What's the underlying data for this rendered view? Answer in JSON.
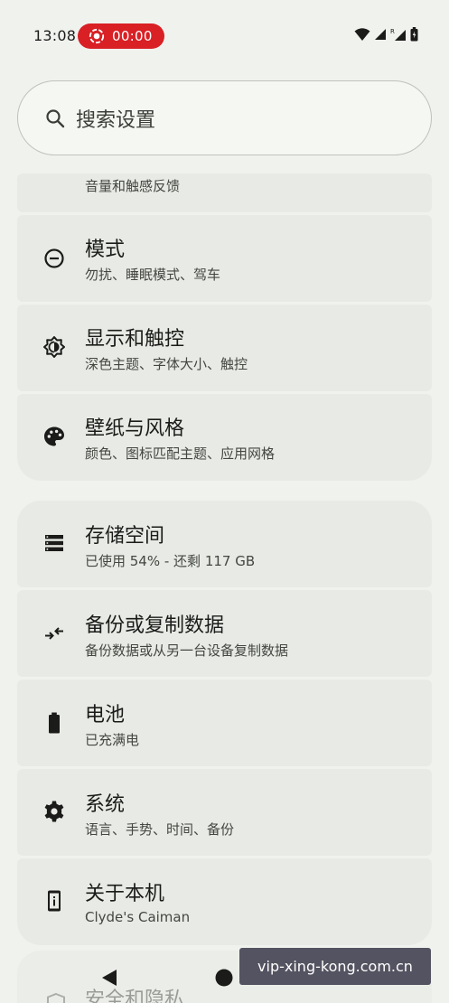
{
  "status_bar": {
    "time": "13:08",
    "recording_timer": "00:00",
    "icons": [
      "wifi-icon",
      "signal-icon",
      "roaming-signal-icon",
      "battery-icon"
    ],
    "roaming_label": "R"
  },
  "search": {
    "placeholder": "搜索设置"
  },
  "groups": [
    {
      "items": [
        {
          "icon": "sound-icon",
          "title": "",
          "subtitle": "音量和触感反馈"
        },
        {
          "icon": "modes-icon",
          "title": "模式",
          "subtitle": "勿扰、睡眠模式、驾车"
        },
        {
          "icon": "display-brightness-icon",
          "title": "显示和触控",
          "subtitle": "深色主题、字体大小、触控"
        },
        {
          "icon": "palette-icon",
          "title": "壁纸与风格",
          "subtitle": "颜色、图标匹配主题、应用网格"
        }
      ]
    },
    {
      "items": [
        {
          "icon": "storage-icon",
          "title": "存储空间",
          "subtitle": "已使用 54% - 还剩 117 GB"
        },
        {
          "icon": "backup-transfer-icon",
          "title": "备份或复制数据",
          "subtitle": "备份数据或从另一台设备复制数据"
        },
        {
          "icon": "battery-icon",
          "title": "电池",
          "subtitle": "已充满电"
        },
        {
          "icon": "gear-icon",
          "title": "系统",
          "subtitle": "语言、手势、时间、备份"
        },
        {
          "icon": "info-device-icon",
          "title": "关于本机",
          "subtitle": "Clyde's Caiman"
        }
      ]
    },
    {
      "items": [
        {
          "icon": "security-icon",
          "title": "安全和隐私",
          "subtitle": ""
        }
      ]
    }
  ],
  "nav": {
    "buttons": [
      "back-icon",
      "home-icon",
      "recents-icon"
    ]
  },
  "watermark": "vip-xing-kong.com.cn",
  "colors": {
    "background": "#f0f2ee",
    "card": "#e8ebe5",
    "recording": "#d92025",
    "watermark_bg": "#545361"
  }
}
